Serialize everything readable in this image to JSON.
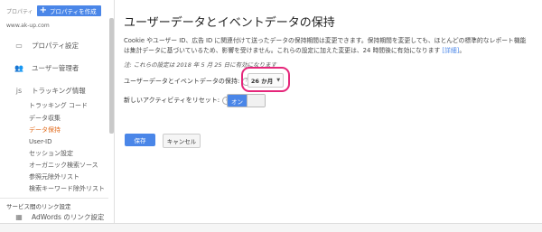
{
  "sidebar": {
    "top_label": "プロパティ",
    "create_button": "プロパティを作成",
    "site_url": "www.ak-up.com",
    "items": [
      {
        "icon": "property-settings-icon",
        "label": "プロパティ設定"
      },
      {
        "icon": "user-management-icon",
        "label": "ユーザー管理者"
      },
      {
        "icon": "js",
        "label": "トラッキング情報"
      }
    ],
    "sub_items": [
      "トラッキング コード",
      "データ収集",
      "データ保持",
      "User-ID",
      "セッション設定",
      "オーガニック検索ソース",
      "参照元除外リスト",
      "検索キーワード除外リスト"
    ],
    "section_title": "サービス間のリンク設定",
    "adwords_label": "AdWords のリンク設定"
  },
  "main": {
    "title": "ユーザーデータとイベントデータの保持",
    "description": "Cookie やユーザー ID、広告 ID に関連付けて送ったデータの保持期間は変更できます。保持期間を変更しても、ほとんどの標準的なレポート機能は集計データに基づいているため、影響を受けません。これらの設定に加えた変更は、24 時間後に有効になります",
    "description_link": "[詳細]",
    "description_end": "。",
    "note": "注: これらの設定は 2018 年 5 月 25 日に有効になります",
    "retention_label": "ユーザーデータとイベントデータの保持:",
    "retention_value": "26 か月",
    "reset_label": "新しいアクティビティをリセット:",
    "reset_toggle": "オン",
    "save_button": "保存",
    "cancel_button": "キャンセル"
  },
  "colors": {
    "accent": "#4a86e8",
    "active_link": "#e0691a",
    "highlight": "#e5267a"
  }
}
